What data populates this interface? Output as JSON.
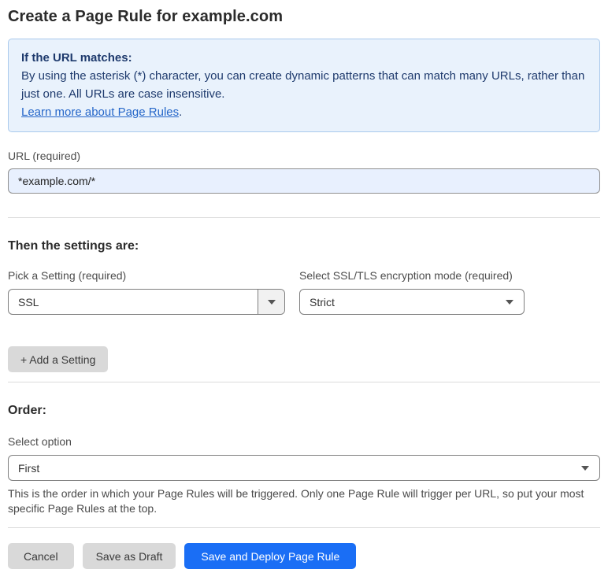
{
  "page": {
    "title": "Create a Page Rule for example.com"
  },
  "info_box": {
    "heading": "If the URL matches:",
    "body": "By using the asterisk (*) character, you can create dynamic patterns that can match many URLs, rather than just one. All URLs are case insensitive.",
    "link_label": "Learn more about Page Rules",
    "link_suffix": "."
  },
  "url_field": {
    "label": "URL (required)",
    "value": "*example.com/*"
  },
  "settings_section": {
    "heading": "Then the settings are:",
    "pick_setting": {
      "label": "Pick a Setting (required)",
      "value": "SSL"
    },
    "encryption_mode": {
      "label": "Select SSL/TLS encryption mode (required)",
      "value": "Strict"
    },
    "add_setting_label": "+ Add a Setting"
  },
  "order_section": {
    "heading": "Order:",
    "select_label": "Select option",
    "value": "First",
    "help_text": "This is the order in which your Page Rules will be triggered. Only one Page Rule will trigger per URL, so put your most specific Page Rules at the top."
  },
  "footer": {
    "cancel_label": "Cancel",
    "save_draft_label": "Save as Draft",
    "save_deploy_label": "Save and Deploy Page Rule"
  },
  "colors": {
    "accent_blue": "#1a6ef5",
    "info_bg": "#e9f2fc",
    "info_border": "#a9c9ec",
    "info_text": "#1e3a6d",
    "link_blue": "#2667c9",
    "input_autofill_bg": "#e8f0fe",
    "button_gray": "#d9d9d9"
  }
}
